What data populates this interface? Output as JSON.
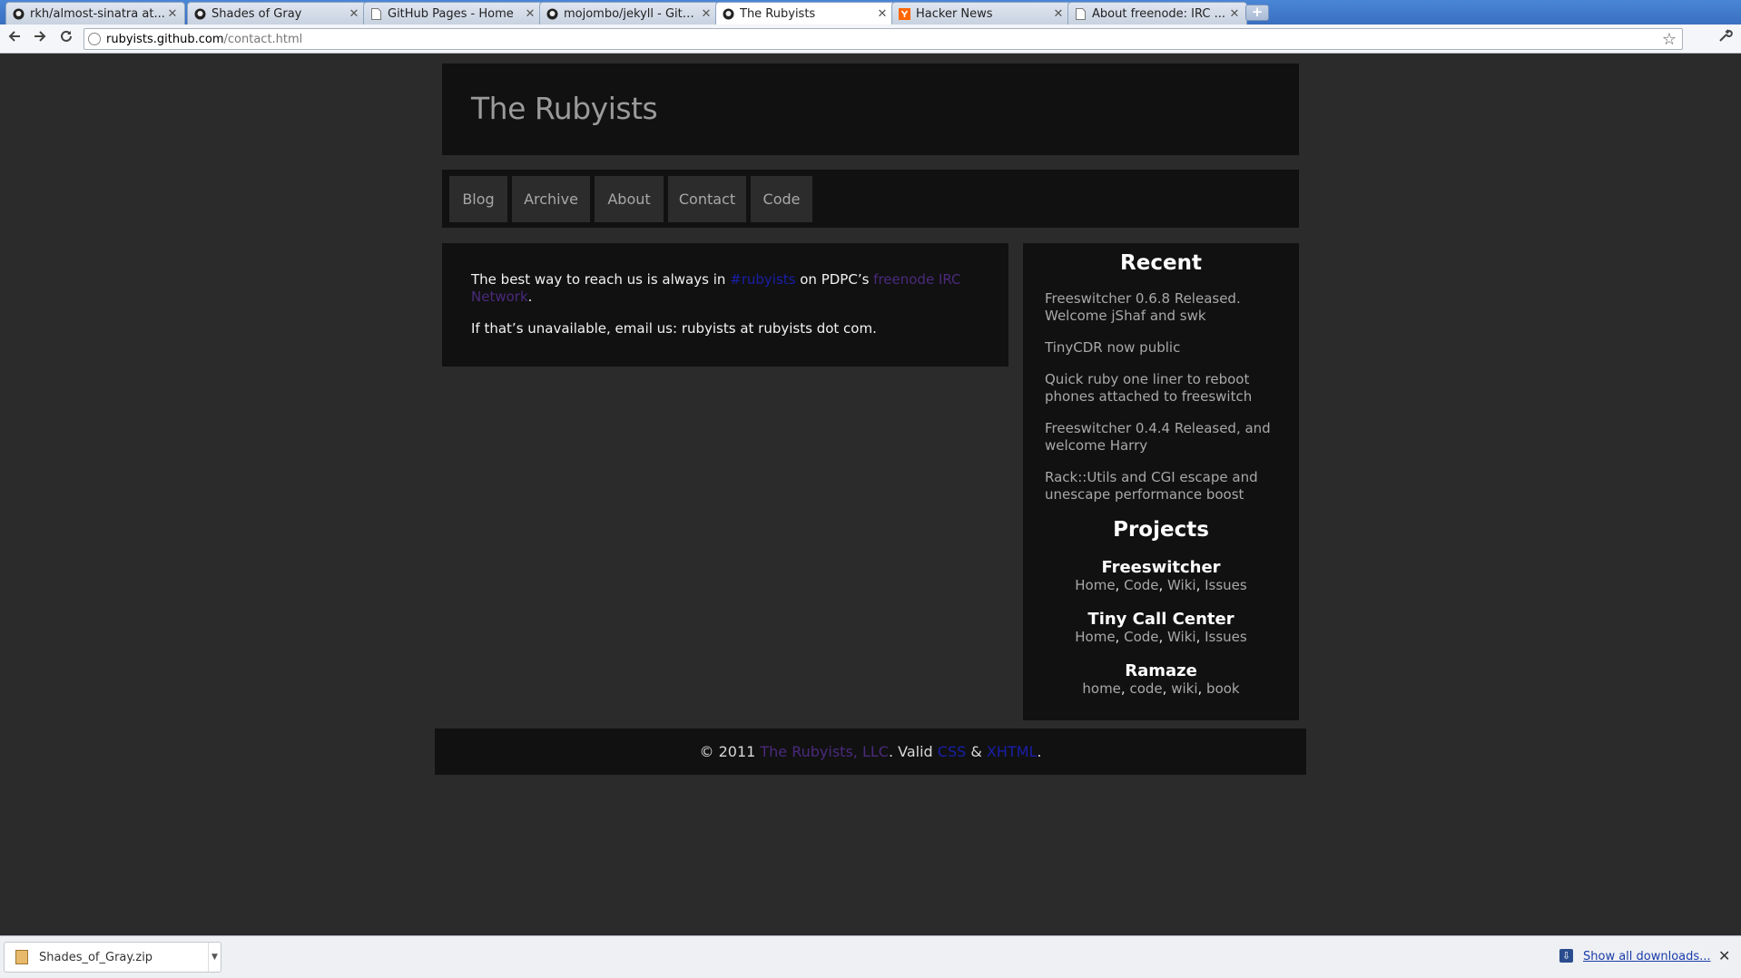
{
  "browser": {
    "tabs": [
      {
        "title": "rkh/almost-sinatra at...",
        "favicon": "github-icon",
        "active": false
      },
      {
        "title": "Shades of Gray",
        "favicon": "github-icon",
        "active": false
      },
      {
        "title": "GitHub Pages - Home",
        "favicon": "page-icon",
        "active": false
      },
      {
        "title": "mojombo/jekyll - GitH...",
        "favicon": "github-icon",
        "active": false
      },
      {
        "title": "The Rubyists",
        "favicon": "github-icon",
        "active": true
      },
      {
        "title": "Hacker News",
        "favicon": "ycombinator-icon",
        "active": false
      },
      {
        "title": "About freenode: IRC ...",
        "favicon": "page-icon",
        "active": false
      }
    ],
    "url_host": "rubyists.github.com",
    "url_path": "/contact.html"
  },
  "site": {
    "title": "The Rubyists",
    "nav": [
      "Blog",
      "Archive",
      "About",
      "Contact",
      "Code"
    ]
  },
  "content": {
    "p1_before": "The best way to reach us is always in ",
    "p1_link1": "#rubyists",
    "p1_middle": " on PDPC’s ",
    "p1_link2": "freenode IRC Network",
    "p1_after": ".",
    "p2": "If that’s unavailable, email us: rubyists at rubyists dot com."
  },
  "sidebar": {
    "recent_heading": "Recent",
    "recent": [
      "Freeswitcher 0.6.8 Released. Welcome jShaf and swk",
      "TinyCDR now public",
      "Quick ruby one liner to reboot phones attached to freeswitch",
      "Freeswitcher 0.4.4 Released, and welcome Harry",
      "Rack::Utils and CGI escape and unescape performance boost"
    ],
    "projects_heading": "Projects",
    "projects": [
      {
        "name": "Freeswitcher",
        "links": [
          "Home",
          "Code",
          "Wiki",
          "Issues"
        ]
      },
      {
        "name": "Tiny Call Center",
        "links": [
          "Home",
          "Code",
          "Wiki",
          "Issues"
        ]
      },
      {
        "name": "Ramaze",
        "links": [
          "home",
          "code",
          "wiki",
          "book"
        ]
      }
    ]
  },
  "footer": {
    "copyright": "© 2011 ",
    "company": "The Rubyists, LLC",
    "valid": ". Valid ",
    "css": "CSS",
    "amp": " & ",
    "xhtml": "XHTML",
    "end": "."
  },
  "downloads": {
    "file": "Shades_of_Gray.zip",
    "show_all": "Show all downloads..."
  }
}
